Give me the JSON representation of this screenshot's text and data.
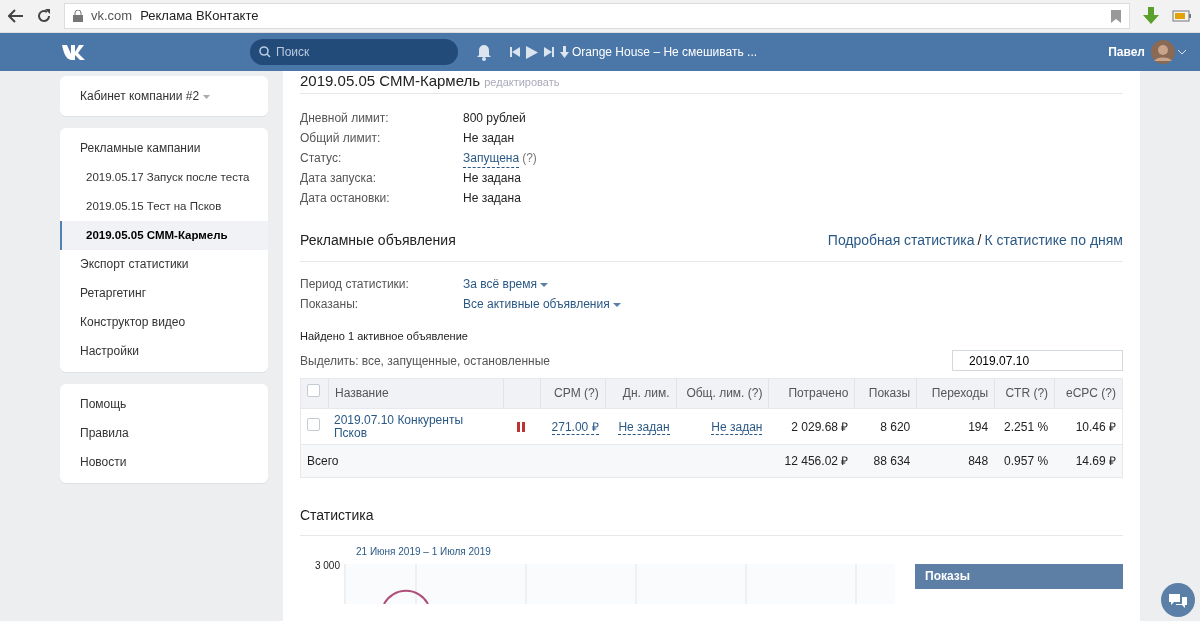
{
  "browser": {
    "url": "vk.com",
    "title": "Реклама ВКонтакте"
  },
  "header": {
    "search_placeholder": "Поиск",
    "track": "Orange House – Не смешивать ...",
    "user": "Павел"
  },
  "sidebar": {
    "cabinet": "Кабинет компании #2",
    "menu": [
      {
        "label": "Рекламные кампании",
        "selected": false,
        "children": [
          {
            "label": "2019.05.17 Запуск после теста",
            "selected": false
          },
          {
            "label": "2019.05.15 Тест на Псков",
            "selected": false
          },
          {
            "label": "2019.05.05 СММ-Кармель",
            "selected": true
          }
        ]
      },
      {
        "label": "Экспорт статистики",
        "selected": false
      },
      {
        "label": "Ретаргетинг",
        "selected": false
      },
      {
        "label": "Конструктор видео",
        "selected": false
      },
      {
        "label": "Настройки",
        "selected": false
      }
    ],
    "links": [
      "Помощь",
      "Правила",
      "Новости"
    ]
  },
  "campaign": {
    "title": "2019.05.05 СММ-Кармель",
    "edit": "редактировать",
    "fields": [
      {
        "label": "Дневной лимит:",
        "value": "800 рублей",
        "kind": "text"
      },
      {
        "label": "Общий лимит:",
        "value": "Не задан",
        "kind": "text"
      },
      {
        "label": "Статус:",
        "value": "Запущена",
        "hint": "(?)",
        "kind": "link"
      },
      {
        "label": "Дата запуска:",
        "value": "Не задана",
        "kind": "text"
      },
      {
        "label": "Дата остановки:",
        "value": "Не задана",
        "kind": "text"
      }
    ]
  },
  "ads": {
    "title": "Рекламные объявления",
    "links": [
      "Подробная статистика",
      "К статистике по дням"
    ],
    "separator": "/",
    "filters": [
      {
        "label": "Период статистики:",
        "value": "За всё время"
      },
      {
        "label": "Показаны:",
        "value": "Все активные объявления"
      }
    ],
    "found": "Найдено 1 активное объявление",
    "select_label": "Выделить:",
    "select_options": "все, запущенные, остановленные",
    "search": "2019.07.10"
  },
  "table": {
    "select_all_checked": false,
    "columns": [
      "Название",
      "",
      "CPM (?)",
      "Дн. лим.",
      "Общ. лим. (?)",
      "Потрачено",
      "Показы",
      "Переходы",
      "CTR (?)",
      "eCPC (?)"
    ],
    "rows": [
      {
        "checked": false,
        "cells": [
          {
            "text": "2019.07.10 Конкуренты Псков",
            "kind": "name"
          },
          {
            "kind": "pause",
            "paused": true
          },
          {
            "text": "271.00 ₽",
            "kind": "link"
          },
          {
            "text": "Не задан",
            "kind": "link"
          },
          {
            "text": "Не задан",
            "kind": "link"
          },
          {
            "text": "2 029.68 ₽",
            "kind": "text"
          },
          {
            "text": "8 620",
            "kind": "text"
          },
          {
            "text": "194",
            "kind": "text"
          },
          {
            "text": "2.251 %",
            "kind": "text"
          },
          {
            "text": "10.46 ₽",
            "kind": "text"
          }
        ]
      }
    ],
    "total": {
      "cells": [
        "Всего",
        "",
        "",
        "",
        "",
        "12 456.02 ₽",
        "88 634",
        "848",
        "0.957 %",
        "14.69 ₽"
      ]
    }
  },
  "stats": {
    "title": "Статистика",
    "period": "21 Июня 2019 – 1 Июля 2019",
    "y_tick": "3 000",
    "legend": "Показы"
  }
}
